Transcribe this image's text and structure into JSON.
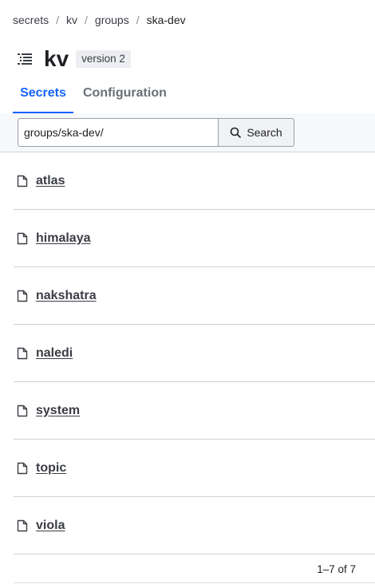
{
  "breadcrumb": {
    "items": [
      "secrets",
      "kv",
      "groups",
      "ska-dev"
    ],
    "separator": "/"
  },
  "header": {
    "title": "kv",
    "version_badge": "version 2"
  },
  "tabs": [
    {
      "label": "Secrets",
      "active": true
    },
    {
      "label": "Configuration",
      "active": false
    }
  ],
  "toolbar": {
    "path_value": "groups/ska-dev/",
    "search_label": "Search"
  },
  "secrets": [
    {
      "name": "atlas"
    },
    {
      "name": "himalaya"
    },
    {
      "name": "nakshatra"
    },
    {
      "name": "naledi"
    },
    {
      "name": "system"
    },
    {
      "name": "topic"
    },
    {
      "name": "viola"
    }
  ],
  "pagination": {
    "summary": "1–7 of 7"
  },
  "colors": {
    "accent": "#1563ff",
    "text": "#3b3d45",
    "border": "#cfd2d8"
  }
}
